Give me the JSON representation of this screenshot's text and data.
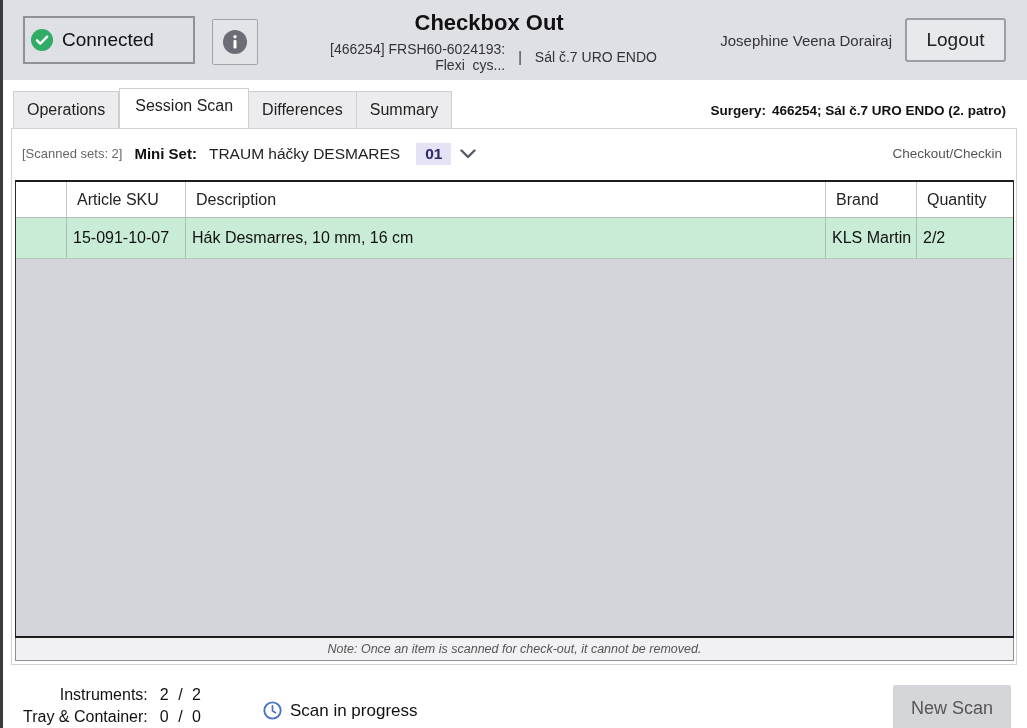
{
  "header": {
    "connection": {
      "label": "Connected",
      "connected": true
    },
    "title": "Checkbox Out",
    "operation": "[466254] FRSH60-6024193: Flexi  cys...",
    "separator": "|",
    "room": "Sál č.7 URO ENDO",
    "user": "Josephine Veena Dorairaj",
    "logout_button": "Logout"
  },
  "tabs": [
    {
      "label": "Operations",
      "selected": false
    },
    {
      "label": "Session Scan",
      "selected": true
    },
    {
      "label": "Differences",
      "selected": false
    },
    {
      "label": "Summary",
      "selected": false
    }
  ],
  "surgery": {
    "label": "Surgery:",
    "value": "466254; Sál č.7 URO ENDO (2. patro)"
  },
  "set_bar": {
    "scanned_sets": "[Scanned sets: 2]",
    "label": "Mini Set:",
    "name": "TRAUM háčky DESMARES",
    "number": "01",
    "mode": "Checkout/Checkin"
  },
  "table": {
    "columns": [
      "Article SKU",
      "Description",
      "Brand",
      "Quantity"
    ],
    "rows": [
      {
        "cells": [
          "15-091-10-07",
          "Hák Desmarres, 10 mm, 16 cm",
          "KLS Martin",
          "2/2"
        ],
        "complete": true
      }
    ]
  },
  "note": "Note: Once an item is scanned for check-out, it cannot be removed.",
  "totals": [
    {
      "label": "Instruments:",
      "value": "2 / 2"
    },
    {
      "label": "Tray & Container:",
      "value": "0 / 0"
    }
  ],
  "status": "Scan in progress",
  "new_scan_button": {
    "label": "New Scan",
    "disabled": true
  }
}
